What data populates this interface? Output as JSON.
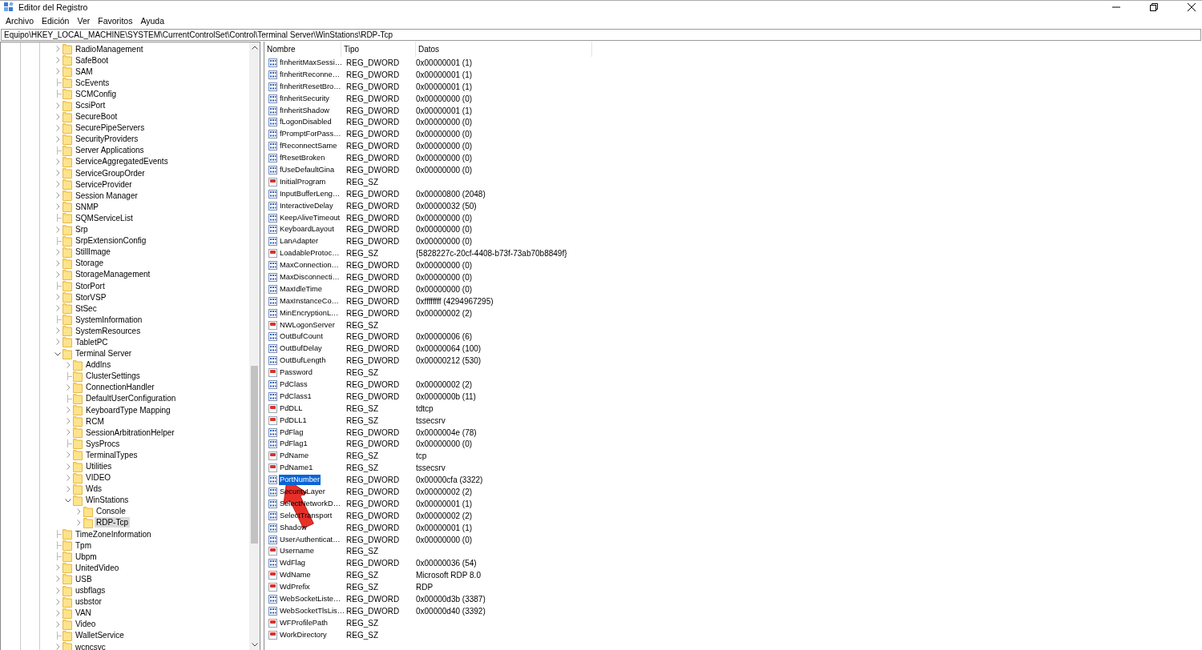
{
  "window": {
    "title": "Editor del Registro"
  },
  "menu": [
    "Archivo",
    "Edición",
    "Ver",
    "Favoritos",
    "Ayuda"
  ],
  "address": "Equipo\\HKEY_LOCAL_MACHINE\\SYSTEM\\CurrentControlSet\\Control\\Terminal Server\\WinStations\\RDP-Tcp",
  "tree": [
    {
      "name": "RadioManagement",
      "kind": "branch",
      "expanded": false,
      "selected": false
    },
    {
      "name": "SafeBoot",
      "kind": "branch",
      "expanded": false,
      "selected": false
    },
    {
      "name": "SAM",
      "kind": "branch",
      "expanded": false,
      "selected": false
    },
    {
      "name": "ScEvents",
      "kind": "leaf",
      "selected": false
    },
    {
      "name": "SCMConfig",
      "kind": "leaf",
      "selected": false
    },
    {
      "name": "ScsiPort",
      "kind": "branch",
      "expanded": false,
      "selected": false
    },
    {
      "name": "SecureBoot",
      "kind": "branch",
      "expanded": false,
      "selected": false
    },
    {
      "name": "SecurePipeServers",
      "kind": "branch",
      "expanded": false,
      "selected": false
    },
    {
      "name": "SecurityProviders",
      "kind": "branch",
      "expanded": false,
      "selected": false
    },
    {
      "name": "Server Applications",
      "kind": "leaf",
      "selected": false
    },
    {
      "name": "ServiceAggregatedEvents",
      "kind": "branch",
      "expanded": false,
      "selected": false
    },
    {
      "name": "ServiceGroupOrder",
      "kind": "branch",
      "expanded": false,
      "selected": false
    },
    {
      "name": "ServiceProvider",
      "kind": "branch",
      "expanded": false,
      "selected": false
    },
    {
      "name": "Session Manager",
      "kind": "branch",
      "expanded": false,
      "selected": false
    },
    {
      "name": "SNMP",
      "kind": "branch",
      "expanded": false,
      "selected": false
    },
    {
      "name": "SQMServiceList",
      "kind": "leaf",
      "selected": false
    },
    {
      "name": "Srp",
      "kind": "branch",
      "expanded": false,
      "selected": false
    },
    {
      "name": "SrpExtensionConfig",
      "kind": "leaf",
      "selected": false
    },
    {
      "name": "StillImage",
      "kind": "branch",
      "expanded": false,
      "selected": false
    },
    {
      "name": "Storage",
      "kind": "branch",
      "expanded": false,
      "selected": false
    },
    {
      "name": "StorageManagement",
      "kind": "branch",
      "expanded": false,
      "selected": false
    },
    {
      "name": "StorPort",
      "kind": "leaf",
      "selected": false
    },
    {
      "name": "StorVSP",
      "kind": "branch",
      "expanded": false,
      "selected": false
    },
    {
      "name": "StSec",
      "kind": "branch",
      "expanded": false,
      "selected": false
    },
    {
      "name": "SystemInformation",
      "kind": "leaf",
      "selected": false
    },
    {
      "name": "SystemResources",
      "kind": "branch",
      "expanded": false,
      "selected": false
    },
    {
      "name": "TabletPC",
      "kind": "branch",
      "expanded": false,
      "selected": false
    },
    {
      "name": "Terminal Server",
      "kind": "branch",
      "expanded": true,
      "selected": false,
      "children": [
        {
          "name": "AddIns",
          "kind": "branch",
          "expanded": false,
          "selected": false
        },
        {
          "name": "ClusterSettings",
          "kind": "leaf",
          "selected": false
        },
        {
          "name": "ConnectionHandler",
          "kind": "branch",
          "expanded": false,
          "selected": false
        },
        {
          "name": "DefaultUserConfiguration",
          "kind": "leaf",
          "selected": false
        },
        {
          "name": "KeyboardType Mapping",
          "kind": "branch",
          "expanded": false,
          "selected": false
        },
        {
          "name": "RCM",
          "kind": "branch",
          "expanded": false,
          "selected": false
        },
        {
          "name": "SessionArbitrationHelper",
          "kind": "branch",
          "expanded": false,
          "selected": false
        },
        {
          "name": "SysProcs",
          "kind": "leaf",
          "selected": false
        },
        {
          "name": "TerminalTypes",
          "kind": "branch",
          "expanded": false,
          "selected": false
        },
        {
          "name": "Utilities",
          "kind": "branch",
          "expanded": false,
          "selected": false
        },
        {
          "name": "VIDEO",
          "kind": "branch",
          "expanded": false,
          "selected": false
        },
        {
          "name": "Wds",
          "kind": "branch",
          "expanded": false,
          "selected": false
        },
        {
          "name": "WinStations",
          "kind": "branch",
          "expanded": true,
          "selected": false,
          "children": [
            {
              "name": "Console",
              "kind": "branch",
              "expanded": false,
              "selected": false
            },
            {
              "name": "RDP-Tcp",
              "kind": "branch",
              "expanded": false,
              "selected": true
            }
          ]
        }
      ]
    },
    {
      "name": "TimeZoneInformation",
      "kind": "leaf",
      "selected": false
    },
    {
      "name": "Tpm",
      "kind": "leaf",
      "selected": false
    },
    {
      "name": "Ubpm",
      "kind": "leaf",
      "selected": false
    },
    {
      "name": "UnitedVideo",
      "kind": "branch",
      "expanded": false,
      "selected": false
    },
    {
      "name": "USB",
      "kind": "branch",
      "expanded": false,
      "selected": false
    },
    {
      "name": "usbflags",
      "kind": "branch",
      "expanded": false,
      "selected": false
    },
    {
      "name": "usbstor",
      "kind": "branch",
      "expanded": false,
      "selected": false
    },
    {
      "name": "VAN",
      "kind": "branch",
      "expanded": false,
      "selected": false
    },
    {
      "name": "Video",
      "kind": "branch",
      "expanded": false,
      "selected": false
    },
    {
      "name": "WalletService",
      "kind": "leaf",
      "selected": false
    },
    {
      "name": "wcncsvc",
      "kind": "branch",
      "expanded": false,
      "selected": false
    }
  ],
  "table": {
    "columns": [
      "Nombre",
      "Tipo",
      "Datos"
    ],
    "rows": [
      {
        "kind": "binary",
        "name": "fInheritMaxSessi…",
        "type": "REG_DWORD",
        "data": "0x00000001 (1)",
        "selected": false
      },
      {
        "kind": "binary",
        "name": "fInheritReconne…",
        "type": "REG_DWORD",
        "data": "0x00000001 (1)",
        "selected": false
      },
      {
        "kind": "binary",
        "name": "fInheritResetBro…",
        "type": "REG_DWORD",
        "data": "0x00000001 (1)",
        "selected": false
      },
      {
        "kind": "binary",
        "name": "fInheritSecurity",
        "type": "REG_DWORD",
        "data": "0x00000000 (0)",
        "selected": false
      },
      {
        "kind": "binary",
        "name": "fInheritShadow",
        "type": "REG_DWORD",
        "data": "0x00000001 (1)",
        "selected": false
      },
      {
        "kind": "binary",
        "name": "fLogonDisabled",
        "type": "REG_DWORD",
        "data": "0x00000000 (0)",
        "selected": false
      },
      {
        "kind": "binary",
        "name": "fPromptForPass…",
        "type": "REG_DWORD",
        "data": "0x00000000 (0)",
        "selected": false
      },
      {
        "kind": "binary",
        "name": "fReconnectSame",
        "type": "REG_DWORD",
        "data": "0x00000000 (0)",
        "selected": false
      },
      {
        "kind": "binary",
        "name": "fResetBroken",
        "type": "REG_DWORD",
        "data": "0x00000000 (0)",
        "selected": false
      },
      {
        "kind": "binary",
        "name": "fUseDefaultGina",
        "type": "REG_DWORD",
        "data": "0x00000000 (0)",
        "selected": false
      },
      {
        "kind": "string",
        "name": "InitialProgram",
        "type": "REG_SZ",
        "selected": false
      },
      {
        "kind": "binary",
        "name": "InputBufferLeng…",
        "type": "REG_DWORD",
        "data": "0x00000800 (2048)",
        "selected": false
      },
      {
        "kind": "binary",
        "name": "InteractiveDelay",
        "type": "REG_DWORD",
        "data": "0x00000032 (50)",
        "selected": false
      },
      {
        "kind": "binary",
        "name": "KeepAliveTimeout",
        "type": "REG_DWORD",
        "data": "0x00000000 (0)",
        "selected": false
      },
      {
        "kind": "binary",
        "name": "KeyboardLayout",
        "type": "REG_DWORD",
        "data": "0x00000000 (0)",
        "selected": false
      },
      {
        "kind": "binary",
        "name": "LanAdapter",
        "type": "REG_DWORD",
        "data": "0x00000000 (0)",
        "selected": false
      },
      {
        "kind": "string",
        "name": "LoadableProtoc…",
        "type": "REG_SZ",
        "data": "{5828227c-20cf-4408-b73f-73ab70b8849f}",
        "selected": false
      },
      {
        "kind": "binary",
        "name": "MaxConnection…",
        "type": "REG_DWORD",
        "data": "0x00000000 (0)",
        "selected": false
      },
      {
        "kind": "binary",
        "name": "MaxDisconnecti…",
        "type": "REG_DWORD",
        "data": "0x00000000 (0)",
        "selected": false
      },
      {
        "kind": "binary",
        "name": "MaxIdleTime",
        "type": "REG_DWORD",
        "data": "0x00000000 (0)",
        "selected": false
      },
      {
        "kind": "binary",
        "name": "MaxInstanceCo…",
        "type": "REG_DWORD",
        "data": "0xffffffff (4294967295)",
        "selected": false
      },
      {
        "kind": "binary",
        "name": "MinEncryptionL…",
        "type": "REG_DWORD",
        "data": "0x00000002 (2)",
        "selected": false
      },
      {
        "kind": "string",
        "name": "NWLogonServer",
        "type": "REG_SZ",
        "selected": false
      },
      {
        "kind": "binary",
        "name": "OutBufCount",
        "type": "REG_DWORD",
        "data": "0x00000006 (6)",
        "selected": false
      },
      {
        "kind": "binary",
        "name": "OutBufDelay",
        "type": "REG_DWORD",
        "data": "0x00000064 (100)",
        "selected": false
      },
      {
        "kind": "binary",
        "name": "OutBufLength",
        "type": "REG_DWORD",
        "data": "0x00000212 (530)",
        "selected": false
      },
      {
        "kind": "string",
        "name": "Password",
        "type": "REG_SZ",
        "selected": false
      },
      {
        "kind": "binary",
        "name": "PdClass",
        "type": "REG_DWORD",
        "data": "0x00000002 (2)",
        "selected": false
      },
      {
        "kind": "binary",
        "name": "PdClass1",
        "type": "REG_DWORD",
        "data": "0x0000000b (11)",
        "selected": false
      },
      {
        "kind": "string",
        "name": "PdDLL",
        "type": "REG_SZ",
        "data": "tdtcp",
        "selected": false
      },
      {
        "kind": "string",
        "name": "PdDLL1",
        "type": "REG_SZ",
        "data": "tssecsrv",
        "selected": false
      },
      {
        "kind": "binary",
        "name": "PdFlag",
        "type": "REG_DWORD",
        "data": "0x0000004e (78)",
        "selected": false
      },
      {
        "kind": "binary",
        "name": "PdFlag1",
        "type": "REG_DWORD",
        "data": "0x00000000 (0)",
        "selected": false
      },
      {
        "kind": "string",
        "name": "PdName",
        "type": "REG_SZ",
        "data": "tcp",
        "selected": false
      },
      {
        "kind": "string",
        "name": "PdName1",
        "type": "REG_SZ",
        "data": "tssecsrv",
        "selected": false
      },
      {
        "kind": "binary",
        "name": "PortNumber",
        "type": "REG_DWORD",
        "data": "0x00000cfa (3322)",
        "selected": true
      },
      {
        "kind": "binary",
        "name": "SecurityLayer",
        "type": "REG_DWORD",
        "data": "0x00000002 (2)",
        "selected": false
      },
      {
        "kind": "binary",
        "name": "SelectNetworkD…",
        "type": "REG_DWORD",
        "data": "0x00000001 (1)",
        "selected": false
      },
      {
        "kind": "binary",
        "name": "SelectTransport",
        "type": "REG_DWORD",
        "data": "0x00000002 (2)",
        "selected": false
      },
      {
        "kind": "binary",
        "name": "Shadow",
        "type": "REG_DWORD",
        "data": "0x00000001 (1)",
        "selected": false
      },
      {
        "kind": "binary",
        "name": "UserAuthenticat…",
        "type": "REG_DWORD",
        "data": "0x00000000 (0)",
        "selected": false
      },
      {
        "kind": "string",
        "name": "Username",
        "type": "REG_SZ",
        "selected": false
      },
      {
        "kind": "binary",
        "name": "WdFlag",
        "type": "REG_DWORD",
        "data": "0x00000036 (54)",
        "selected": false
      },
      {
        "kind": "string",
        "name": "WdName",
        "type": "REG_SZ",
        "data": "Microsoft RDP 8.0",
        "selected": false
      },
      {
        "kind": "string",
        "name": "WdPrefix",
        "type": "REG_SZ",
        "data": "RDP",
        "selected": false
      },
      {
        "kind": "binary",
        "name": "WebSocketListe…",
        "type": "REG_DWORD",
        "data": "0x00000d3b (3387)",
        "selected": false
      },
      {
        "kind": "binary",
        "name": "WebSocketTlsLis…",
        "type": "REG_DWORD",
        "data": "0x00000d40 (3392)",
        "selected": false
      },
      {
        "kind": "string",
        "name": "WFProfilePath",
        "type": "REG_SZ",
        "selected": false
      },
      {
        "kind": "string",
        "name": "WorkDirectory",
        "type": "REG_SZ",
        "selected": false
      }
    ]
  }
}
